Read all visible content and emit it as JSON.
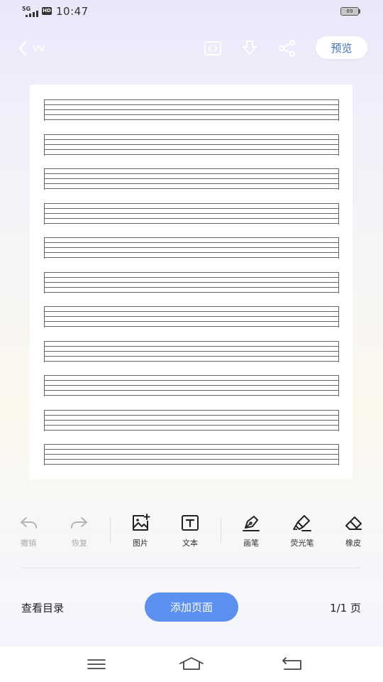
{
  "status_bar": {
    "network": "5G",
    "hd": "HD",
    "time": "10:47",
    "battery": "89"
  },
  "header": {
    "title": "vv",
    "preview_label": "预览",
    "icons": [
      "back-chevron-icon",
      "code-icon",
      "download-icon",
      "share-icon"
    ]
  },
  "sheet": {
    "staff_count": 11,
    "lines_per_staff": 5
  },
  "toolbar": {
    "tools": [
      {
        "id": "undo",
        "label": "撤销",
        "icon": "undo-icon",
        "enabled": false
      },
      {
        "id": "redo",
        "label": "恢复",
        "icon": "redo-icon",
        "enabled": false
      },
      {
        "id": "image",
        "label": "图片",
        "icon": "add-image-icon",
        "enabled": true
      },
      {
        "id": "text",
        "label": "文本",
        "icon": "text-box-icon",
        "enabled": true
      },
      {
        "id": "pen",
        "label": "画笔",
        "icon": "pen-icon",
        "enabled": true
      },
      {
        "id": "highlighter",
        "label": "荧光笔",
        "icon": "highlighter-icon",
        "enabled": true
      },
      {
        "id": "eraser",
        "label": "橡皮",
        "icon": "eraser-icon",
        "enabled": true
      }
    ]
  },
  "bottom": {
    "toc_label": "查看目录",
    "add_page_label": "添加页面",
    "page_indicator": "1/1 页"
  },
  "colors": {
    "accent": "#5b8ff0",
    "preview_text": "#3d6fb8",
    "disabled": "#aaaaaa",
    "staff_line": "#666666"
  }
}
